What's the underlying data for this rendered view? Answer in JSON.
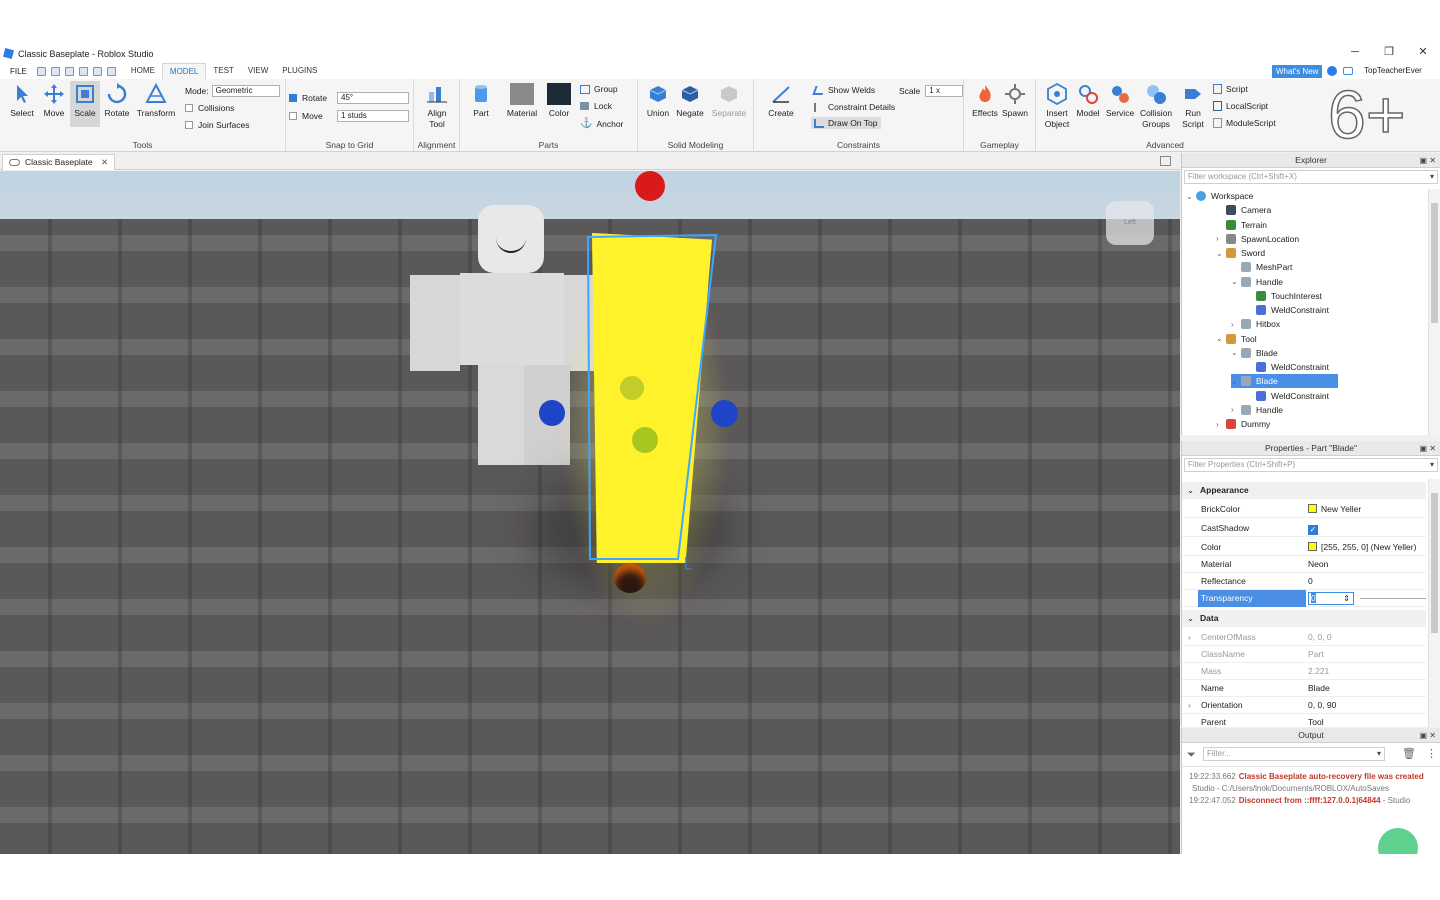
{
  "window": {
    "title": "Classic Baseplate - Roblox Studio",
    "minimize": "─",
    "maximize": "❐",
    "close": "✕"
  },
  "menu": {
    "file": "FILE",
    "tabs": [
      "HOME",
      "MODEL",
      "TEST",
      "VIEW",
      "PLUGINS"
    ],
    "active_tab": "MODEL",
    "whats_new": "What's New",
    "username": "TopTeacherEver"
  },
  "ribbon": {
    "tools": {
      "label": "Tools",
      "buttons": [
        "Select",
        "Move",
        "Scale",
        "Rotate",
        "Transform"
      ],
      "selected": "Scale",
      "mode_label": "Mode:",
      "mode_value": "Geometric",
      "collisions": "Collisions",
      "join_surfaces": "Join Surfaces"
    },
    "snap": {
      "label": "Snap to Grid",
      "rotate": "Rotate",
      "rotate_value": "45°",
      "move": "Move",
      "move_value": "1 studs"
    },
    "alignment": {
      "label": "Alignment",
      "align_tool_1": "Align",
      "align_tool_2": "Tool"
    },
    "parts": {
      "label": "Parts",
      "part": "Part",
      "material": "Material",
      "color": "Color",
      "group": "Group",
      "lock": "Lock",
      "anchor": "Anchor"
    },
    "solid": {
      "label": "Solid Modeling",
      "union": "Union",
      "negate": "Negate",
      "separate": "Separate"
    },
    "constraints": {
      "label": "Constraints",
      "create": "Create",
      "show_welds": "Show Welds",
      "constraint_details": "Constraint Details",
      "draw_on_top": "Draw On Top",
      "scale_label": "Scale",
      "scale_value": "1 x"
    },
    "gameplay": {
      "label": "Gameplay",
      "effects": "Effects",
      "spawn": "Spawn"
    },
    "advanced": {
      "label": "Advanced",
      "insert_1": "Insert",
      "insert_2": "Object",
      "model": "Model",
      "service": "Service",
      "collision_1": "Collision",
      "collision_2": "Groups",
      "run_1": "Run",
      "run_2": "Script",
      "script": "Script",
      "local_script": "LocalScript",
      "module_script": "ModuleScript"
    },
    "logo_text": "6+"
  },
  "document_tab": {
    "label": "Classic Baseplate",
    "close": "✕"
  },
  "viewport": {
    "view_cube_label": "Left",
    "colors": {
      "sky": "#c4d6e3",
      "floor": "#615e5f",
      "neon": "#fff22a",
      "selection": "#3ea6ff"
    }
  },
  "explorer": {
    "title": "Explorer",
    "filter_placeholder": "Filter workspace (Ctrl+Shift+X)",
    "items": [
      {
        "label": "Workspace",
        "arrow": "⌄",
        "icon": "workspace"
      },
      {
        "label": "Camera",
        "arrow": "",
        "icon": "camera"
      },
      {
        "label": "Terrain",
        "arrow": "",
        "icon": "terrain"
      },
      {
        "label": "SpawnLocation",
        "arrow": "›",
        "icon": "spawn"
      },
      {
        "label": "Sword",
        "arrow": "⌄",
        "icon": "tool"
      },
      {
        "label": "MeshPart",
        "arrow": "",
        "icon": "part"
      },
      {
        "label": "Handle",
        "arrow": "⌄",
        "icon": "part"
      },
      {
        "label": "TouchInterest",
        "arrow": "",
        "icon": "touch"
      },
      {
        "label": "WeldConstraint",
        "arrow": "",
        "icon": "weld"
      },
      {
        "label": "Hitbox",
        "arrow": "›",
        "icon": "part"
      },
      {
        "label": "Tool",
        "arrow": "⌄",
        "icon": "tool"
      },
      {
        "label": "Blade",
        "arrow": "⌄",
        "icon": "part"
      },
      {
        "label": "WeldConstraint",
        "arrow": "",
        "icon": "weld"
      },
      {
        "label": "Blade",
        "arrow": "⌄",
        "icon": "part"
      },
      {
        "label": "WeldConstraint",
        "arrow": "",
        "icon": "weld"
      },
      {
        "label": "Handle",
        "arrow": "›",
        "icon": "part"
      },
      {
        "label": "Dummy",
        "arrow": "›",
        "icon": "model"
      }
    ]
  },
  "properties": {
    "title": "Properties - Part \"Blade\"",
    "filter_placeholder": "Filter Properties (Ctrl+Shift+P)",
    "sections": {
      "appearance": "Appearance",
      "data": "Data"
    },
    "appearance": [
      {
        "name": "BrickColor",
        "value": "New Yeller"
      },
      {
        "name": "CastShadow",
        "value": ""
      },
      {
        "name": "Color",
        "value": "[255, 255, 0] (New Yeller)"
      },
      {
        "name": "Material",
        "value": "Neon"
      },
      {
        "name": "Reflectance",
        "value": "0"
      },
      {
        "name": "Transparency",
        "value": "0"
      }
    ],
    "data": [
      {
        "name": "CenterOfMass",
        "value": "0, 0, 0"
      },
      {
        "name": "ClassName",
        "value": "Part"
      },
      {
        "name": "Mass",
        "value": "2.221"
      },
      {
        "name": "Name",
        "value": "Blade"
      },
      {
        "name": "Orientation",
        "value": "0, 0, 90"
      },
      {
        "name": "Parent",
        "value": "Tool"
      }
    ]
  },
  "output": {
    "title": "Output",
    "filter_placeholder": "Filter...",
    "lines": [
      {
        "time": "19:22:33.662",
        "text": "Classic Baseplate auto-recovery file was created",
        "color": "#c0392b"
      },
      {
        "time": "",
        "text": "Studio - C:/Users/lnok/Documents/ROBLOX/AutoSaves",
        "color": "#777777"
      },
      {
        "time": "19:22:47.052",
        "text": "Disconnect from ::ffff:127.0.0.1|64844",
        "color": "#c0392b",
        "suffix": " - Studio"
      }
    ]
  }
}
